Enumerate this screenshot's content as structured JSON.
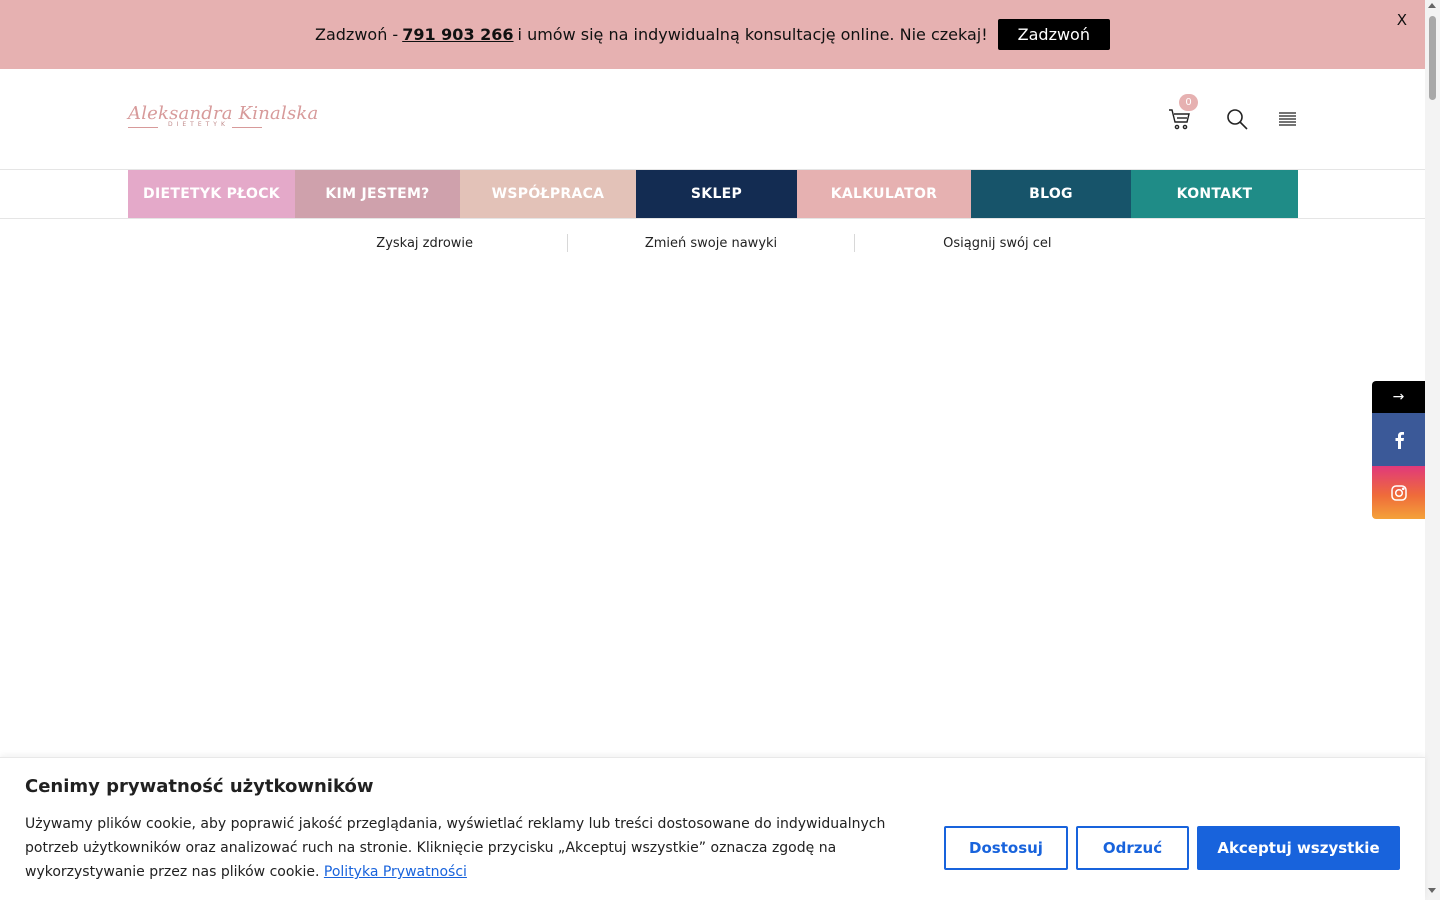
{
  "promo": {
    "text_before": "Zadzwoń -",
    "phone": "791 903 266",
    "text_after": "i umów się na indywidualną konsultację online. Nie czekaj!",
    "button_label": "Zadzwoń",
    "close_label": "X",
    "background": "#e6b1b1"
  },
  "header": {
    "logo_script": "Aleksandra Kinalska",
    "logo_sub": "DIETETYK",
    "cart_count": "0",
    "icons": [
      "cart-icon",
      "search-icon",
      "hamburger-icon"
    ]
  },
  "nav": {
    "items": [
      {
        "label": "DIETETYK PŁOCK",
        "color": "#e4a9c9"
      },
      {
        "label": "KIM JESTEM?",
        "color": "#cfa1ac"
      },
      {
        "label": "WSPÓŁPRACA",
        "color": "#e3c2b8"
      },
      {
        "label": "SKLEP",
        "color": "#132c52"
      },
      {
        "label": "KALKULATOR",
        "color": "#e6b1b1"
      },
      {
        "label": "BLOG",
        "color": "#17546a"
      },
      {
        "label": "KONTAKT",
        "color": "#1f8c87"
      }
    ]
  },
  "submenu": {
    "items": [
      "Zyskaj zdrowie",
      "Zmień swoje nawyki",
      "Osiągnij swój cel"
    ]
  },
  "social": {
    "arrow": "→",
    "items": [
      "facebook-icon",
      "instagram-icon"
    ]
  },
  "cookie": {
    "title": "Cenimy prywatność użytkowników",
    "text": "Używamy plików cookie, aby poprawić jakość przeglądania, wyświetlać reklamy lub treści dostosowane do indywidualnych potrzeb użytkowników oraz analizować ruch na stronie. Kliknięcie przycisku „Akceptuj wszystkie” oznacza zgodę na wykorzystywanie przez nas plików cookie.",
    "link": "Polityka Prywatności",
    "customize_label": "Dostosuj",
    "reject_label": "Odrzuć",
    "accept_label": "Akceptuj wszystkie",
    "accent": "#1863dc"
  }
}
